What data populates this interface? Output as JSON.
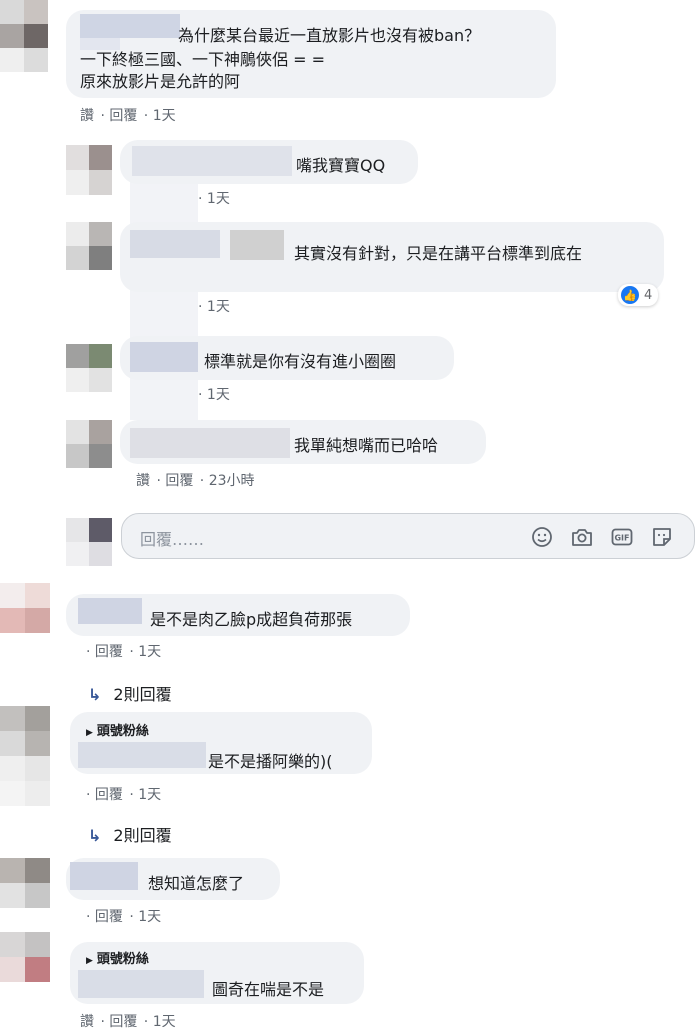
{
  "comments": [
    {
      "text_lines": [
        "為什麼某台最近一直放影片也沒有被ban？",
        "一下終極三國、一下神鵰俠侶 = =",
        "原來放影片是允許的阿"
      ],
      "actions": {
        "like": "讚",
        "reply": "回覆",
        "time": "1天"
      }
    }
  ],
  "replies": [
    {
      "text": "嘴我寶寶QQ",
      "time": "1天"
    },
    {
      "text": "其實沒有針對，只是在講平台標準到底在",
      "time": "1天",
      "reaction_count": "4"
    },
    {
      "text": "標準就是你有沒有進小圈圈",
      "time": "1天"
    },
    {
      "text": "我單純想嘴而已哈哈",
      "like": "讚",
      "reply": "回覆",
      "time": "23小時"
    }
  ],
  "composer": {
    "placeholder": "回覆……",
    "icons": [
      "emoji-icon",
      "camera-icon",
      "gif-icon",
      "sticker-icon"
    ]
  },
  "thread2": {
    "comment": {
      "text": "是不是肉乙臉p成超負荷那張",
      "reply": "回覆",
      "time": "1天"
    },
    "view_replies": "2則回覆",
    "reply": {
      "badge": "頭號粉絲",
      "text": "是不是播阿樂的)(",
      "reply": "回覆",
      "time": "1天"
    },
    "view_replies2": "2則回覆"
  },
  "thread3": {
    "comment": {
      "text": "想知道怎麼了",
      "reply": "回覆",
      "time": "1天"
    },
    "reply": {
      "badge": "頭號粉絲",
      "text": "圖奇在喘是不是",
      "like": "讚",
      "reply": "回覆",
      "time": "1天"
    }
  }
}
